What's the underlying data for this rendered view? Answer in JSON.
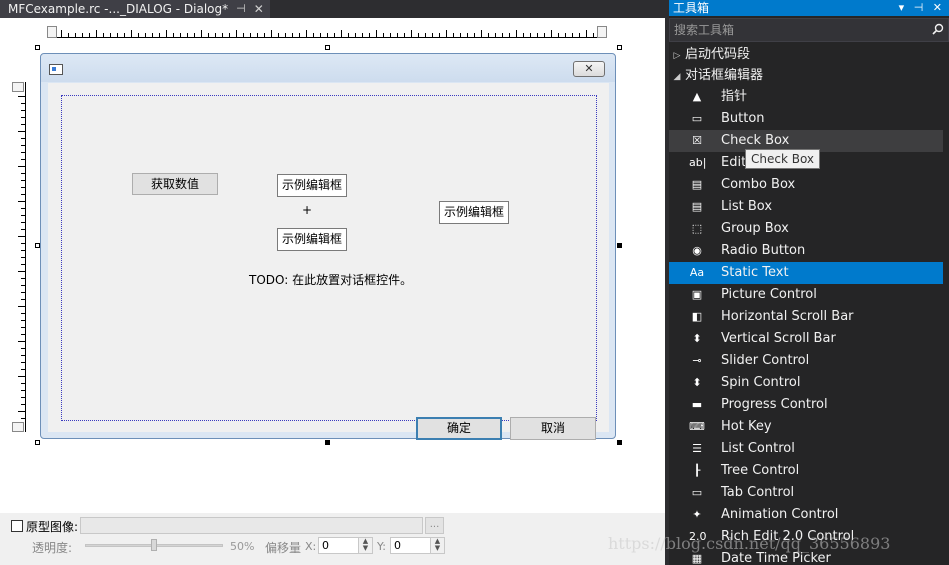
{
  "doc_tab": {
    "title": "MFCexample.rc -..._DIALOG - Dialog*",
    "pin": "⊣",
    "close": "✕"
  },
  "dialog": {
    "close_glyph": "✕",
    "get_value_button": "获取数值",
    "edit_1": "示例编辑框",
    "plus": "+",
    "edit_2": "示例编辑框",
    "edit_3": "示例编辑框",
    "todo_text": "TODO: 在此放置对话框控件。",
    "ok_button": "确定",
    "cancel_button": "取消"
  },
  "bottom_bar": {
    "proto_label": "原型图像:",
    "browse": "...",
    "opacity_label": "透明度:",
    "opacity_value": "50%",
    "opacity_fraction": 0.5,
    "offset_label": "偏移量",
    "x_label": "X:",
    "x_value": "0",
    "y_label": "Y:",
    "y_value": "0"
  },
  "toolbox": {
    "title": "工具箱",
    "header_icons": "▾ ⊣ ✕",
    "search_placeholder": "搜索工具箱",
    "groups": [
      {
        "label": "启动代码段",
        "expanded": false
      },
      {
        "label": "对话框编辑器",
        "expanded": true
      }
    ],
    "items": [
      {
        "label": "指针",
        "icon": "pointer-icon",
        "glyph": "▲"
      },
      {
        "label": "Button",
        "icon": "button-icon",
        "glyph": "▭"
      },
      {
        "label": "Check Box",
        "icon": "check-box-icon",
        "glyph": "☒"
      },
      {
        "label": "Edit Control",
        "icon": "edit-control-icon",
        "glyph": "ab|"
      },
      {
        "label": "Combo Box",
        "icon": "combo-box-icon",
        "glyph": "▤"
      },
      {
        "label": "List Box",
        "icon": "list-box-icon",
        "glyph": "▤"
      },
      {
        "label": "Group Box",
        "icon": "group-box-icon",
        "glyph": "⬚"
      },
      {
        "label": "Radio Button",
        "icon": "radio-button-icon",
        "glyph": "◉"
      },
      {
        "label": "Static Text",
        "icon": "static-text-icon",
        "glyph": "Aa"
      },
      {
        "label": "Picture Control",
        "icon": "picture-control-icon",
        "glyph": "▣"
      },
      {
        "label": "Horizontal Scroll Bar",
        "icon": "horizontal-scroll-bar-icon",
        "glyph": "◧"
      },
      {
        "label": "Vertical Scroll Bar",
        "icon": "vertical-scroll-bar-icon",
        "glyph": "⬍"
      },
      {
        "label": "Slider Control",
        "icon": "slider-control-icon",
        "glyph": "⊸"
      },
      {
        "label": "Spin Control",
        "icon": "spin-control-icon",
        "glyph": "⬍"
      },
      {
        "label": "Progress Control",
        "icon": "progress-control-icon",
        "glyph": "▬"
      },
      {
        "label": "Hot Key",
        "icon": "hot-key-icon",
        "glyph": "⌨"
      },
      {
        "label": "List Control",
        "icon": "list-control-icon",
        "glyph": "☰"
      },
      {
        "label": "Tree Control",
        "icon": "tree-control-icon",
        "glyph": "┠"
      },
      {
        "label": "Tab Control",
        "icon": "tab-control-icon",
        "glyph": "▭"
      },
      {
        "label": "Animation Control",
        "icon": "animation-control-icon",
        "glyph": "✦"
      },
      {
        "label": "Rich Edit 2.0 Control",
        "icon": "rich-edit-icon",
        "glyph": "2.0"
      },
      {
        "label": "Date Time Picker",
        "icon": "date-time-picker-icon",
        "glyph": "▦"
      }
    ],
    "hover_index": 2,
    "selected_index": 8,
    "tooltip": "Check Box"
  },
  "watermark": "https://blog.csdn.net/qq_36556893",
  "colors": {
    "accent": "#007acc",
    "panel": "#252526",
    "dialog_border": "#3c7fb1"
  }
}
